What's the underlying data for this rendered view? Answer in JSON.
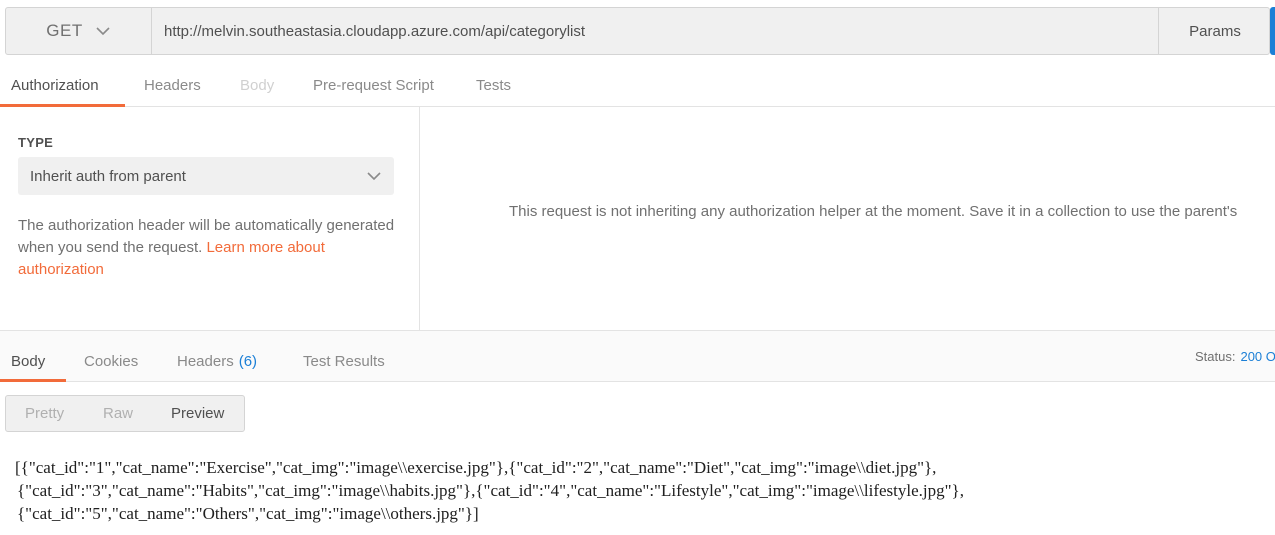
{
  "request": {
    "method": "GET",
    "url": "http://melvin.southeastasia.cloudapp.azure.com/api/categorylist",
    "params_label": "Params"
  },
  "request_tabs": [
    {
      "label": "Authorization",
      "state": "active"
    },
    {
      "label": "Headers",
      "state": "normal"
    },
    {
      "label": "Body",
      "state": "disabled"
    },
    {
      "label": "Pre-request Script",
      "state": "normal"
    },
    {
      "label": "Tests",
      "state": "normal"
    }
  ],
  "auth": {
    "type_label": "TYPE",
    "type_value": "Inherit auth from parent",
    "description": "The authorization header will be automatically generated when you send the request.",
    "link_text": "Learn more about authorization",
    "message": "This request is not inheriting any authorization helper at the moment. Save it in a collection to use the parent's"
  },
  "response_tabs": [
    {
      "label": "Body",
      "state": "active"
    },
    {
      "label": "Cookies",
      "state": "normal"
    },
    {
      "label": "Headers",
      "count": "(6)",
      "state": "normal"
    },
    {
      "label": "Test Results",
      "state": "normal"
    }
  ],
  "status": {
    "label": "Status:",
    "value": "200 O"
  },
  "view_modes": [
    {
      "label": "Pretty",
      "state": "disabled"
    },
    {
      "label": "Raw",
      "state": "normal"
    },
    {
      "label": "Preview",
      "state": "active"
    }
  ],
  "preview_lines": [
    "[{\"cat_id\":\"1\",\"cat_name\":\"Exercise\",\"cat_img\":\"image\\\\exercise.jpg\"},{\"cat_id\":\"2\",\"cat_name\":\"Diet\",\"cat_img\":\"image\\\\diet.jpg\"},",
    "{\"cat_id\":\"3\",\"cat_name\":\"Habits\",\"cat_img\":\"image\\\\habits.jpg\"},{\"cat_id\":\"4\",\"cat_name\":\"Lifestyle\",\"cat_img\":\"image\\\\lifestyle.jpg\"},",
    "{\"cat_id\":\"5\",\"cat_name\":\"Others\",\"cat_img\":\"image\\\\others.jpg\"}]"
  ],
  "colors": {
    "accent": "#f26b3a",
    "link_blue": "#1b7fd6"
  },
  "icons": {
    "method_dropdown": "chevron-down-icon",
    "type_dropdown": "chevron-down-icon"
  }
}
